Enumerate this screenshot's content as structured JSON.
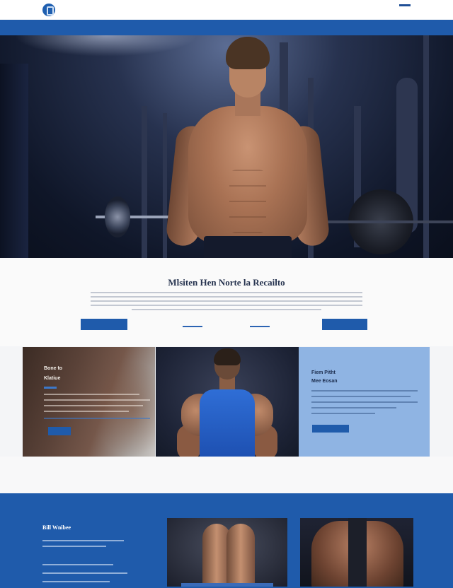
{
  "header": {
    "logo_text": "",
    "utility_links": [
      "",
      "",
      "",
      ""
    ]
  },
  "nav": {
    "items": [
      "",
      "",
      "",
      "",
      "",
      "",
      "",
      "",
      "",
      "",
      ""
    ]
  },
  "intro": {
    "title": "Mlsiten Hen Norte la Recailto",
    "primary_button": "",
    "secondary_button": ""
  },
  "features": {
    "dark_card": {
      "line1": "Bone to",
      "line2": "Klatiue",
      "button": ""
    },
    "light_card": {
      "line1": "Fiem Pitht",
      "line2": "Mee Eosan",
      "button": ""
    }
  },
  "band": {
    "title": "Bill Wnibee"
  },
  "colors": {
    "brand_blue": "#1f5bab",
    "light_blue_card": "#8fb4e3",
    "hero_dark": "#0f1628"
  }
}
